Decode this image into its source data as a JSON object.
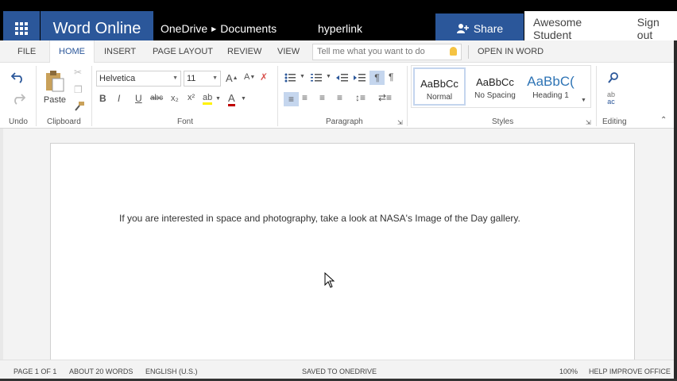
{
  "header": {
    "app_name": "Word Online",
    "breadcrumb": [
      "OneDrive",
      "Documents"
    ],
    "doc_title": "hyperlink",
    "share_label": "Share",
    "user_name": "Awesome Student",
    "signout_label": "Sign out",
    "brand_color": "#2b579a"
  },
  "tabs": {
    "file": "FILE",
    "home": "HOME",
    "insert": "INSERT",
    "page_layout": "PAGE LAYOUT",
    "review": "REVIEW",
    "view": "VIEW",
    "tell_me_placeholder": "Tell me what you want to do",
    "open_in_word": "OPEN IN WORD"
  },
  "ribbon": {
    "undo_label": "Undo",
    "paste_label": "Paste",
    "clipboard_label": "Clipboard",
    "font_name": "Helvetica",
    "font_size": "11",
    "font_label": "Font",
    "paragraph_label": "Paragraph",
    "styles": [
      {
        "sample": "AaBbCc",
        "name": "Normal"
      },
      {
        "sample": "AaBbCc",
        "name": "No Spacing"
      },
      {
        "sample": "AaBbC(",
        "name": "Heading 1"
      }
    ],
    "styles_label": "Styles",
    "editing_label": "Editing",
    "bold": "B",
    "italic": "I",
    "underline": "U",
    "strike": "abc",
    "subscript": "x₂",
    "superscript": "x²",
    "highlight": "ab",
    "font_color": "A"
  },
  "document": {
    "body_text": "If you are interested in space and photography, take a look at NASA's Image of the Day gallery."
  },
  "status": {
    "page": "PAGE 1 OF 1",
    "words": "ABOUT 20 WORDS",
    "language": "ENGLISH (U.S.)",
    "saved": "SAVED TO ONEDRIVE",
    "zoom": "100%",
    "help": "HELP IMPROVE OFFICE"
  }
}
